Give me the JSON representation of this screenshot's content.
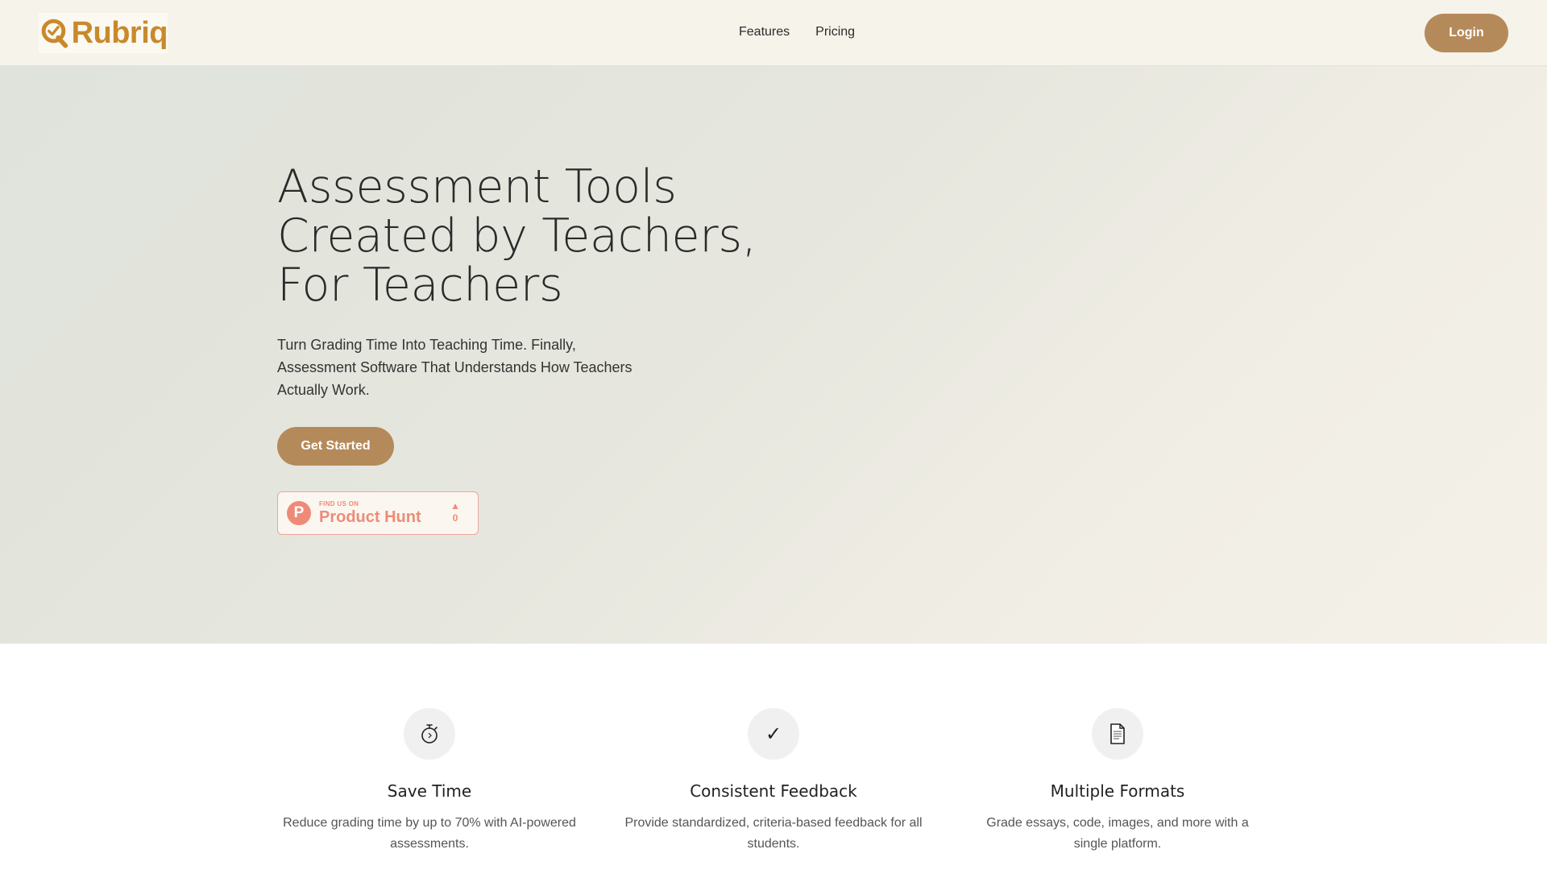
{
  "header": {
    "logo_text": "Rubriq",
    "nav": [
      {
        "label": "Features"
      },
      {
        "label": "Pricing"
      }
    ],
    "login_label": "Login"
  },
  "hero": {
    "title_lines": [
      "Assessment Tools",
      "Created by Teachers,",
      "For Teachers"
    ],
    "subtitle": "Turn Grading Time Into Teaching Time. Finally, Assessment Software That Understands How Teachers Actually Work.",
    "cta_label": "Get Started",
    "product_hunt": {
      "small_label": "FIND US ON",
      "big_label": "Product Hunt",
      "logo_letter": "P",
      "arrow": "▲",
      "votes": "0"
    }
  },
  "features": [
    {
      "icon": "stopwatch-icon",
      "glyph": "⏱",
      "title": "Save Time",
      "description": "Reduce grading time by up to 70% with AI-powered assessments."
    },
    {
      "icon": "checkmark-icon",
      "glyph": "✓",
      "title": "Consistent Feedback",
      "description": "Provide standardized, criteria-based feedback for all students."
    },
    {
      "icon": "document-icon",
      "glyph": "🗎",
      "title": "Multiple Formats",
      "description": "Grade essays, code, images, and more with a single platform."
    }
  ],
  "colors": {
    "accent": "#b58a5a",
    "logo": "#c9892b",
    "product_hunt": "#ee8b78",
    "header_bg": "#f5f3ea"
  }
}
